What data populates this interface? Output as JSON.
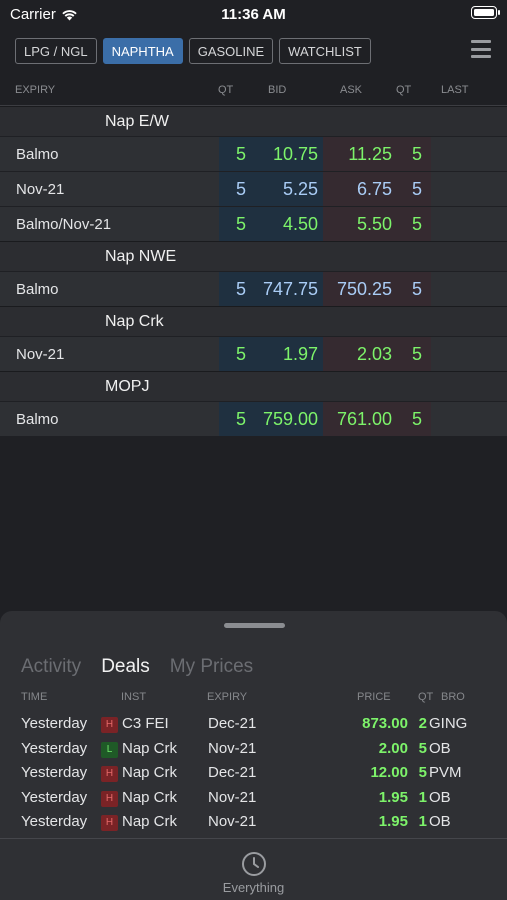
{
  "status_bar": {
    "carrier": "Carrier",
    "time": "11:36 AM"
  },
  "tabs": [
    {
      "label": "LPG / NGL",
      "active": false
    },
    {
      "label": "NAPHTHA",
      "active": true
    },
    {
      "label": "GASOLINE",
      "active": false
    },
    {
      "label": "WATCHLIST",
      "active": false
    }
  ],
  "columns": {
    "expiry": "EXPIRY",
    "bid_qt": "QT",
    "bid": "BID",
    "ask": "ASK",
    "ask_qt": "QT",
    "last": "LAST"
  },
  "groups": [
    {
      "title": "Nap E/W",
      "rows": [
        {
          "expiry": "Balmo",
          "bid_qt": "5",
          "bid": "10.75",
          "ask": "11.25",
          "ask_qt": "5",
          "color": "green"
        },
        {
          "expiry": "Nov-21",
          "bid_qt": "5",
          "bid": "5.25",
          "ask": "6.75",
          "ask_qt": "5",
          "color": "blue"
        },
        {
          "expiry": "Balmo/Nov-21",
          "bid_qt": "5",
          "bid": "4.50",
          "ask": "5.50",
          "ask_qt": "5",
          "color": "green"
        }
      ]
    },
    {
      "title": "Nap NWE",
      "rows": [
        {
          "expiry": "Balmo",
          "bid_qt": "5",
          "bid": "747.75",
          "ask": "750.25",
          "ask_qt": "5",
          "color": "blue"
        }
      ]
    },
    {
      "title": "Nap Crk",
      "rows": [
        {
          "expiry": "Nov-21",
          "bid_qt": "5",
          "bid": "1.97",
          "ask": "2.03",
          "ask_qt": "5",
          "color": "green"
        }
      ]
    },
    {
      "title": "MOPJ",
      "rows": [
        {
          "expiry": "Balmo",
          "bid_qt": "5",
          "bid": "759.00",
          "ask": "761.00",
          "ask_qt": "5",
          "color": "green"
        }
      ]
    }
  ],
  "sheet": {
    "tabs": [
      {
        "label": "Activity",
        "active": false
      },
      {
        "label": "Deals",
        "active": true
      },
      {
        "label": "My Prices",
        "active": false
      }
    ],
    "columns": {
      "time": "TIME",
      "inst": "INST",
      "expiry": "EXPIRY",
      "price": "PRICE",
      "qt": "QT",
      "bro": "BRO"
    },
    "deals": [
      {
        "time": "Yesterday",
        "side": "H",
        "inst": "C3 FEI",
        "expiry": "Dec-21",
        "price": "873.00",
        "qt": "2",
        "bro": "GING"
      },
      {
        "time": "Yesterday",
        "side": "L",
        "inst": "Nap Crk",
        "expiry": "Nov-21",
        "price": "2.00",
        "qt": "5",
        "bro": "OB"
      },
      {
        "time": "Yesterday",
        "side": "H",
        "inst": "Nap Crk",
        "expiry": "Dec-21",
        "price": "12.00",
        "qt": "5",
        "bro": "PVM"
      },
      {
        "time": "Yesterday",
        "side": "H",
        "inst": "Nap Crk",
        "expiry": "Nov-21",
        "price": "1.95",
        "qt": "1",
        "bro": "OB"
      },
      {
        "time": "Yesterday",
        "side": "H",
        "inst": "Nap Crk",
        "expiry": "Nov-21",
        "price": "1.95",
        "qt": "1",
        "bro": "OB"
      }
    ],
    "nav": {
      "label": "Everything",
      "icon": "clock-icon"
    }
  },
  "colors": {
    "accent": "#3b6ea8",
    "green": "#7df36a",
    "blue": "#a9ccf5",
    "high": "#7a2326",
    "low": "#1f5a27"
  }
}
